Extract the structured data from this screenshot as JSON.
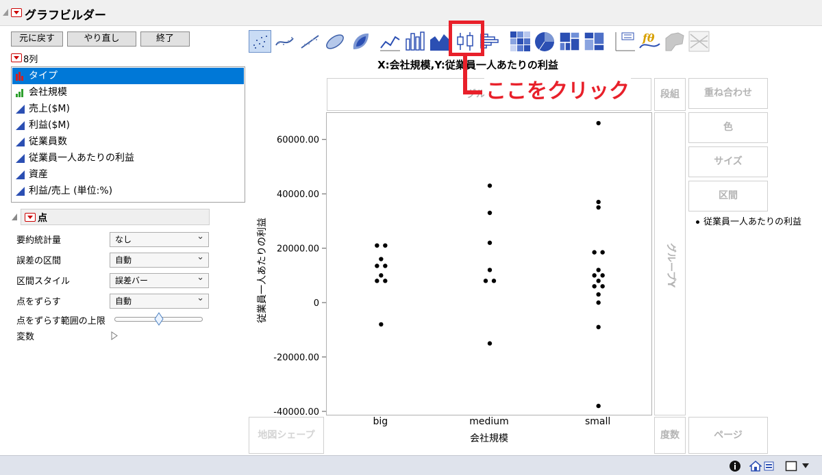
{
  "window": {
    "title": "グラフビルダー"
  },
  "buttons": {
    "undo": "元に戻す",
    "redo": "やり直し",
    "done": "終了"
  },
  "columns": {
    "count_label": "8列",
    "items": [
      {
        "label": "タイプ",
        "icon": "nominal-bar-icon",
        "selected": true
      },
      {
        "label": "会社規模",
        "icon": "ordinal-bar-icon"
      },
      {
        "label": "売上($M)",
        "icon": "continuous-icon"
      },
      {
        "label": "利益($M)",
        "icon": "continuous-icon"
      },
      {
        "label": "従業員数",
        "icon": "continuous-icon"
      },
      {
        "label": "従業員一人あたりの利益",
        "icon": "continuous-icon"
      },
      {
        "label": "資産",
        "icon": "continuous-icon"
      },
      {
        "label": "利益/売上 (単位:%)",
        "icon": "continuous-icon"
      }
    ]
  },
  "points_panel": {
    "title": "点",
    "summary_stat": {
      "label": "要約統計量",
      "value": "なし"
    },
    "error_interval": {
      "label": "誤差の区間",
      "value": "自動"
    },
    "interval_style": {
      "label": "区間スタイル",
      "value": "誤差バー"
    },
    "jitter": {
      "label": "点をずらす",
      "value": "自動"
    },
    "jitter_limit": {
      "label": "点をずらす範囲の上限",
      "slider_value": 0.5
    },
    "variables": {
      "label": "変数"
    }
  },
  "toolbar": {
    "icons": [
      "points-icon",
      "smoother-icon",
      "line-of-fit-icon",
      "ellipse-icon",
      "contour-icon",
      "line-icon",
      "bar-icon",
      "area-icon",
      "box-plot-icon",
      "histogram-icon",
      "heatmap-icon",
      "pie-icon",
      "treemap-icon",
      "mosaic-icon",
      "caption-box-icon",
      "formula-icon",
      "map-shape-icon",
      "parallel-icon"
    ],
    "highlighted": "box-plot-icon"
  },
  "annotation": {
    "text": "ここをクリック",
    "color": "#e8202a"
  },
  "zones": {
    "group_x": "グループX",
    "wrap": "段組",
    "overlay": "重ね合わせ",
    "color": "色",
    "size": "サイズ",
    "interval": "区間",
    "group_y": "グループY",
    "map_shape": "地図シェープ",
    "freq": "度数",
    "page": "ページ"
  },
  "legend": {
    "items": [
      "従業員一人あたりの利益"
    ]
  },
  "chart_data": {
    "type": "scatter",
    "title": "X:会社規模,Y:従業員一人あたりの利益",
    "xlabel": "会社規模",
    "ylabel": "従業員一人あたりの利益",
    "categories": [
      "big",
      "medium",
      "small"
    ],
    "yticks": [
      "60000.00",
      "40000.00",
      "20000.00",
      "0",
      "-20000.00",
      "-40000.00"
    ],
    "ylim": [
      -41500,
      70000
    ],
    "points": [
      {
        "x": "big",
        "y": 21000,
        "j": -0.15
      },
      {
        "x": "big",
        "y": 21000,
        "j": 0.15
      },
      {
        "x": "big",
        "y": 16000,
        "j": 0
      },
      {
        "x": "big",
        "y": 13500,
        "j": -0.15
      },
      {
        "x": "big",
        "y": 13500,
        "j": 0.15
      },
      {
        "x": "big",
        "y": 10000,
        "j": 0
      },
      {
        "x": "big",
        "y": 8000,
        "j": -0.15
      },
      {
        "x": "big",
        "y": 8000,
        "j": 0.15
      },
      {
        "x": "big",
        "y": -8000,
        "j": 0
      },
      {
        "x": "medium",
        "y": 43000,
        "j": 0
      },
      {
        "x": "medium",
        "y": 33000,
        "j": 0
      },
      {
        "x": "medium",
        "y": 22000,
        "j": 0
      },
      {
        "x": "medium",
        "y": 12000,
        "j": 0
      },
      {
        "x": "medium",
        "y": 8000,
        "j": -0.15
      },
      {
        "x": "medium",
        "y": 8000,
        "j": 0.15
      },
      {
        "x": "medium",
        "y": -15000,
        "j": 0
      },
      {
        "x": "small",
        "y": 66000,
        "j": 0
      },
      {
        "x": "small",
        "y": 37000,
        "j": 0
      },
      {
        "x": "small",
        "y": 35000,
        "j": 0
      },
      {
        "x": "small",
        "y": 18500,
        "j": -0.15
      },
      {
        "x": "small",
        "y": 18500,
        "j": 0.15
      },
      {
        "x": "small",
        "y": 12000,
        "j": 0
      },
      {
        "x": "small",
        "y": 10000,
        "j": -0.15
      },
      {
        "x": "small",
        "y": 10000,
        "j": 0.15
      },
      {
        "x": "small",
        "y": 8000,
        "j": 0
      },
      {
        "x": "small",
        "y": 6000,
        "j": -0.15
      },
      {
        "x": "small",
        "y": 6000,
        "j": 0.15
      },
      {
        "x": "small",
        "y": 3000,
        "j": 0
      },
      {
        "x": "small",
        "y": 0,
        "j": 0
      },
      {
        "x": "small",
        "y": -9000,
        "j": 0
      },
      {
        "x": "small",
        "y": -38000,
        "j": 0
      }
    ],
    "grid": false,
    "legend_position": "right"
  }
}
